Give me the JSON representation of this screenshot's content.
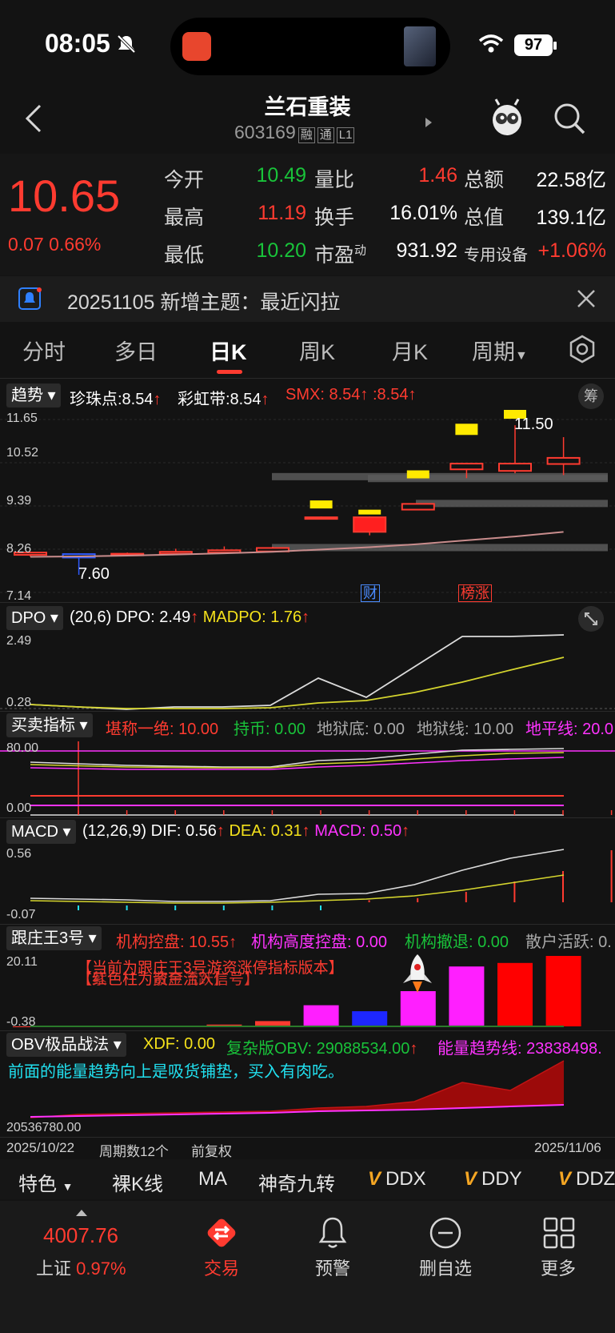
{
  "status_bar": {
    "time": "08:05",
    "battery": "97"
  },
  "nav": {
    "title": "兰石重装",
    "code": "603169",
    "badges": [
      "融",
      "通",
      "L1"
    ]
  },
  "quote": {
    "price": "10.65",
    "change": "0.07 0.66%",
    "rows": [
      [
        {
          "label": "今开",
          "value": "10.49",
          "color": "green"
        },
        {
          "label": "量比",
          "value": "1.46",
          "color": "red"
        },
        {
          "label": "总额",
          "value": "22.58亿",
          "color": "white"
        }
      ],
      [
        {
          "label": "最高",
          "value": "11.19",
          "color": "red"
        },
        {
          "label": "换手",
          "value": "16.01%",
          "color": "white"
        },
        {
          "label": "总值",
          "value": "139.1亿",
          "color": "white"
        }
      ],
      [
        {
          "label": "最低",
          "value": "10.20",
          "color": "green"
        },
        {
          "label": "市盈",
          "value": "931.92",
          "color": "white"
        },
        {
          "label": "专用设备",
          "value": "+1.06%",
          "color": "red"
        }
      ]
    ],
    "pe_sup": "动"
  },
  "notice": {
    "text": "20251105 新增主题：最近闪拉"
  },
  "tabs": [
    "分时",
    "多日",
    "日K",
    "周K",
    "月K",
    "周期"
  ],
  "active_tab": "日K",
  "trend": {
    "btn": "趋势",
    "pearl": "珍珠点:8.54",
    "rainbow": "彩虹带:8.54",
    "smx": "SMX: 8.54",
    "smx2": ":8.54",
    "chip": "筹",
    "y_top": "11.65",
    "y2": "10.52",
    "y3": "9.39",
    "y4": "8.26",
    "y_bottom": "7.14",
    "high_label": "11.50",
    "low_label": "7.60",
    "tag_cai": "财",
    "tag_bang": "榜涨"
  },
  "dpo": {
    "btn": "DPO",
    "params": "(20,6)",
    "dpo": "DPO: 2.49",
    "madpo": "MADPO: 1.76",
    "y_top": "2.49",
    "y_bottom": "0.28"
  },
  "maimai": {
    "btn": "买卖指标",
    "items": [
      {
        "text": "堪称一绝: 10.00",
        "color": "red"
      },
      {
        "text": "持币: 0.00",
        "color": "green"
      },
      {
        "text": "地狱底: 0.00",
        "color": "gray"
      },
      {
        "text": "地狱线: 10.00",
        "color": "gray"
      },
      {
        "text": "地平线: 20.0",
        "color": "magenta"
      }
    ],
    "y_top": "80.00",
    "y_bottom": "0.00"
  },
  "macd": {
    "btn": "MACD",
    "params": "(12,26,9)",
    "dif": "DIF: 0.56",
    "dea": "DEA: 0.31",
    "macd": "MACD: 0.50",
    "y_top": "0.56",
    "y_bottom": "-0.07"
  },
  "gzw": {
    "btn": "跟庄王3号",
    "items": [
      {
        "text": "机构控盘: 10.55",
        "color": "red"
      },
      {
        "text": "机构高度控盘: 0.00",
        "color": "magenta"
      },
      {
        "text": "机构撤退: 0.00",
        "color": "green"
      },
      {
        "text": "散户活跃: 0.",
        "color": "gray"
      }
    ],
    "y_top": "20.11",
    "y_bottom": "-0.38",
    "overlay1": "【当前为跟庄王3号游资涨停指标版本】",
    "overlay2": "【红色柱为资金流入信号】",
    "overlay3": "【紫色柱为散户活跃】"
  },
  "obv": {
    "btn": "OBV极品战法",
    "xdf": "XDF: 0.00",
    "fzb": "复杂版OBV: 29088534.00",
    "energy": "能量趋势线: 23838498.",
    "desc": "前面的能量趋势向上是吸货铺垫，买入有肉吃。",
    "y_bottom": "20536780.00"
  },
  "footer_info": {
    "start_date": "2025/10/22",
    "period": "周期数12个",
    "adjust": "前复权",
    "end_date": "2025/11/06"
  },
  "toolbar": {
    "items": [
      "特色",
      "裸K线",
      "MA",
      "神奇九转",
      "DDX",
      "DDY",
      "DDZ"
    ]
  },
  "bottom_nav": {
    "index_value": "4007.76",
    "index_name": "上证",
    "index_change": "0.97%",
    "items": [
      "交易",
      "预警",
      "删自选",
      "更多"
    ]
  },
  "chart_data": {
    "type": "candlestick",
    "y_range": [
      7.14,
      11.65
    ],
    "candles": [
      {
        "open": 8.12,
        "close": 8.18,
        "high": 8.2,
        "low": 8.07
      },
      {
        "open": 8.14,
        "close": 8.05,
        "high": 8.16,
        "low": 7.6
      },
      {
        "open": 8.12,
        "close": 8.15,
        "high": 8.18,
        "low": 8.1
      },
      {
        "open": 8.15,
        "close": 8.2,
        "high": 8.28,
        "low": 8.13
      },
      {
        "open": 8.18,
        "close": 8.24,
        "high": 8.34,
        "low": 8.16
      },
      {
        "open": 8.21,
        "close": 8.3,
        "high": 8.33,
        "low": 8.19
      },
      {
        "open": 9.1,
        "close": 9.1,
        "high": 9.12,
        "low": 9.08
      },
      {
        "open": 8.72,
        "close": 9.1,
        "high": 9.12,
        "low": 8.63
      },
      {
        "open": 9.3,
        "close": 9.45,
        "high": 9.46,
        "low": 9.28
      },
      {
        "open": 10.35,
        "close": 10.5,
        "high": 10.52,
        "low": 10.12
      },
      {
        "open": 10.31,
        "close": 10.5,
        "high": 11.5,
        "low": 10.25
      },
      {
        "open": 10.49,
        "close": 10.65,
        "high": 11.19,
        "low": 10.2
      }
    ]
  }
}
